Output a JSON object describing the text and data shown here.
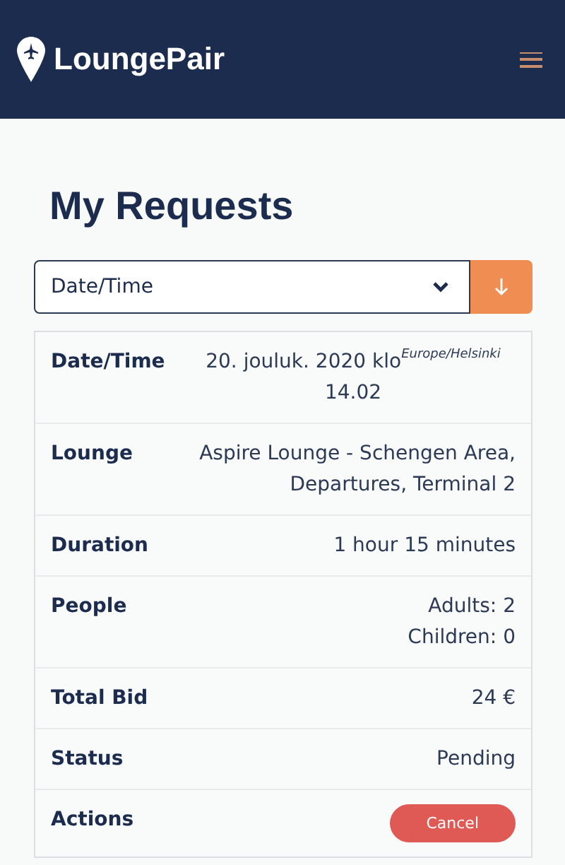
{
  "header": {
    "brand": "LoungePair"
  },
  "title": "My Requests",
  "sort": {
    "value": "Date/Time"
  },
  "rows": [
    {
      "kind": "text",
      "label": "Date/Time",
      "value": "20. jouluk. 2020 klo$^{Europe/Helsinki}$ 14.02"
    },
    {
      "kind": "text",
      "label": "Lounge",
      "value": "Aspire Lounge - Schengen Area, Departures, Terminal 2"
    },
    {
      "kind": "text",
      "label": "Duration",
      "value": "1 hour 15 minutes"
    },
    {
      "kind": "lines",
      "label": "People",
      "lines": [
        "Adults: 2",
        "Children: 0"
      ]
    },
    {
      "kind": "text",
      "label": "Total Bid",
      "value": "24 €"
    },
    {
      "kind": "text",
      "label": "Status",
      "value": "Pending"
    },
    {
      "kind": "button",
      "label": "Actions",
      "button": "Cancel"
    }
  ]
}
